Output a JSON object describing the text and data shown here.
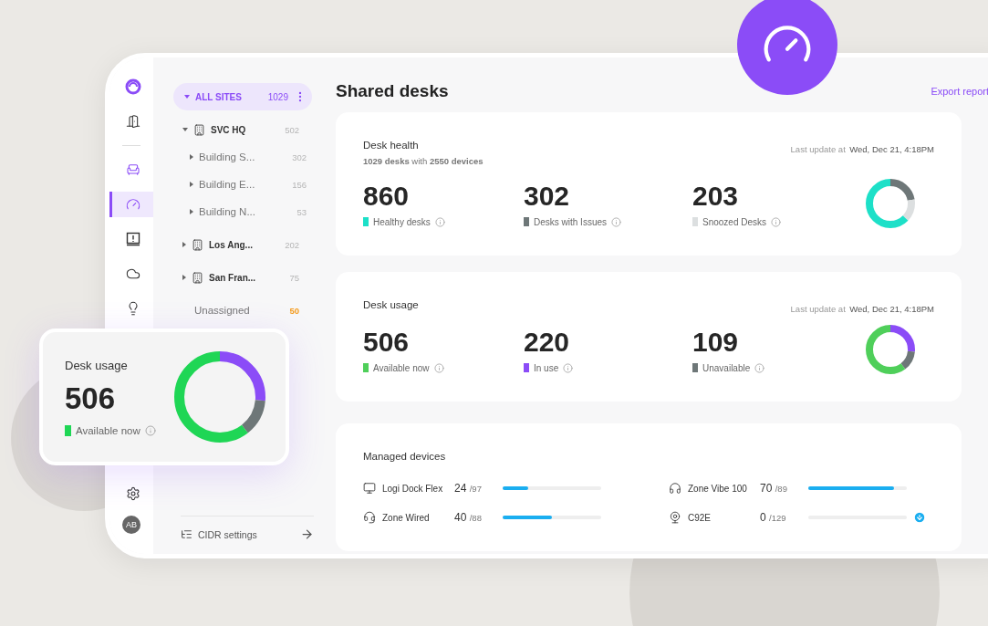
{
  "rail": {
    "top": [
      {
        "kind": "logo",
        "selected": false
      },
      {
        "kind": "door",
        "selected": false
      },
      {
        "kind": "divider"
      },
      {
        "kind": "desk",
        "selected": false
      },
      {
        "kind": "gauge",
        "selected": true
      },
      {
        "kind": "alert",
        "selected": false
      },
      {
        "kind": "cloud",
        "selected": false
      },
      {
        "kind": "bulb",
        "selected": false
      }
    ],
    "bottom": [
      {
        "kind": "gear",
        "selected": false
      },
      {
        "kind": "avatar",
        "initials": "AB",
        "selected": false
      }
    ]
  },
  "tree": {
    "label": "ALL SITES",
    "count": "1029",
    "selected": true,
    "expanded": true,
    "children": [
      {
        "kind": "site",
        "label": "SVC HQ",
        "count": "502",
        "expanded": true,
        "children": [
          {
            "kind": "building",
            "label": "Building S...",
            "count": "302",
            "expanded": false
          },
          {
            "kind": "building",
            "label": "Building E...",
            "count": "156",
            "expanded": false
          },
          {
            "kind": "building",
            "label": "Building N...",
            "count": "53",
            "expanded": false
          }
        ]
      },
      {
        "kind": "site",
        "label": "Los Ang...",
        "count": "202",
        "expanded": false
      },
      {
        "kind": "site",
        "label": "San Fran...",
        "count": "75",
        "expanded": false
      },
      {
        "kind": "unassigned",
        "label": "Unassigned",
        "count": "50"
      }
    ]
  },
  "footer_link": "CIDR settings",
  "page_title": "Shared desks",
  "export_link": "Export report",
  "cards": [
    {
      "title": "Desk health",
      "subtitle": "**1029 desks** with **2550 devices**",
      "update_label": "Last update at",
      "update_time": "Wed, Dec 21, 4:18PM",
      "stats": [
        {
          "value": "860",
          "label": "Healthy desks",
          "color": "#1de0c8"
        },
        {
          "value": "302",
          "label": "Desks with Issues",
          "color": "#6e7778"
        },
        {
          "value": "203",
          "label": "Snoozed Desks",
          "color": "#dcdfe0"
        }
      ]
    },
    {
      "title": "Desk usage",
      "update_label": "Last update at",
      "update_time": "Wed, Dec 21, 4:18PM",
      "stats": [
        {
          "value": "506",
          "label": "Available now",
          "color": "#4fcf5a"
        },
        {
          "value": "220",
          "label": "In use",
          "color": "#8b4cf7"
        },
        {
          "value": "109",
          "label": "Unavailable",
          "color": "#6e7778"
        }
      ]
    }
  ],
  "devices": {
    "title": "Managed devices",
    "items": [
      {
        "kind": "dock",
        "name": "Logi Dock Flex",
        "count": "24",
        "total": "/97",
        "level": 0.26,
        "update_available": false
      },
      {
        "kind": "headphones",
        "name": "Zone Vibe 100",
        "count": "70",
        "total": "/89",
        "level": 0.87,
        "update_available": false
      },
      {
        "kind": "headset",
        "name": "Zone Wired",
        "count": "40",
        "total": "/88",
        "level": 0.5,
        "update_available": false
      },
      {
        "kind": "webcam",
        "name": "C92E",
        "count": "0",
        "total": "/129",
        "level": 0,
        "update_available": true
      }
    ]
  },
  "float_card": {
    "title": "Desk usage",
    "value": "506",
    "label": "Available now",
    "color": "#1fd655"
  }
}
